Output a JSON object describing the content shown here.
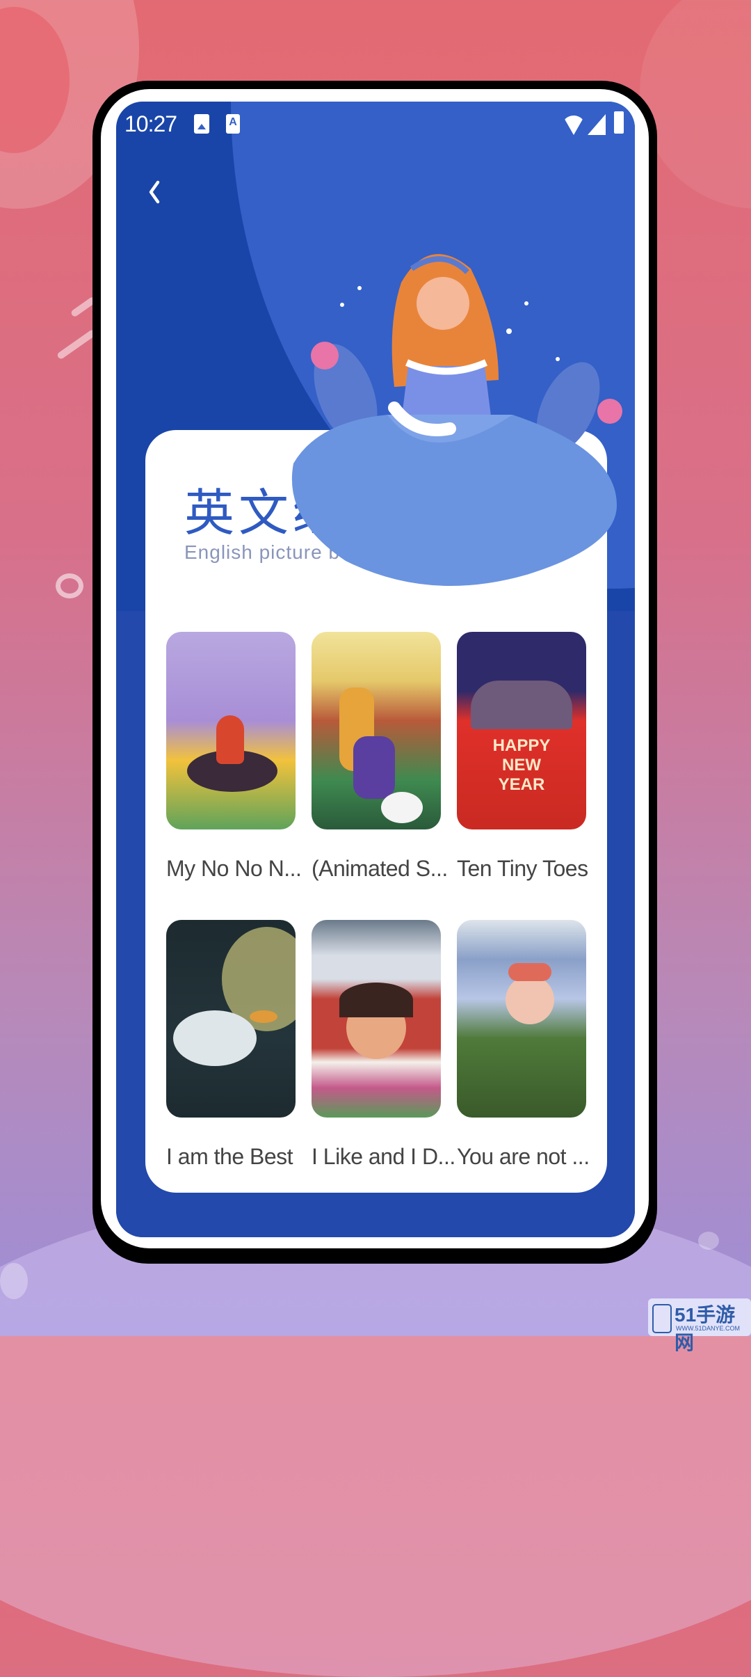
{
  "status_bar": {
    "time": "10:27",
    "notification_icons": [
      "gallery-icon",
      "font-a-icon"
    ],
    "system_icons": [
      "wifi-icon",
      "signal-icon",
      "battery-charging-icon"
    ]
  },
  "nav": {
    "back_label": "‹"
  },
  "header": {
    "title_cn": "英文绘本",
    "title_en": "English picture books"
  },
  "books": [
    {
      "title": "My No No N...",
      "cover_colors": [
        "#b8a8e0",
        "#f2c23c",
        "#5fa35a"
      ]
    },
    {
      "title": "(Animated S...",
      "cover_colors": [
        "#f1e39a",
        "#5a3fa0",
        "#3f8a50"
      ]
    },
    {
      "title": "Ten Tiny Toes",
      "cover_colors": [
        "#2f2a6a",
        "#e0302a",
        "#ffe08a"
      ]
    },
    {
      "title": "I am the Best",
      "cover_colors": [
        "#1d2b30",
        "#dfe6ea",
        "#e6c66a"
      ]
    },
    {
      "title": "I Like and I D...",
      "cover_colors": [
        "#d8dde6",
        "#c2433a",
        "#e8c28a"
      ]
    },
    {
      "title": "You are not ...",
      "cover_colors": [
        "#b8c6e6",
        "#4f7a3a",
        "#f0c4b0"
      ]
    }
  ],
  "colors": {
    "accent": "#2f5ac2",
    "screen_bg": "#1a45a8",
    "screen_arc": "#3460c8",
    "card_bg": "#ffffff",
    "title_text": "#444444",
    "subtitle_text": "#8a95ba"
  },
  "watermark": {
    "text": "51手游网",
    "url": "WWW.51DANYE.COM"
  }
}
